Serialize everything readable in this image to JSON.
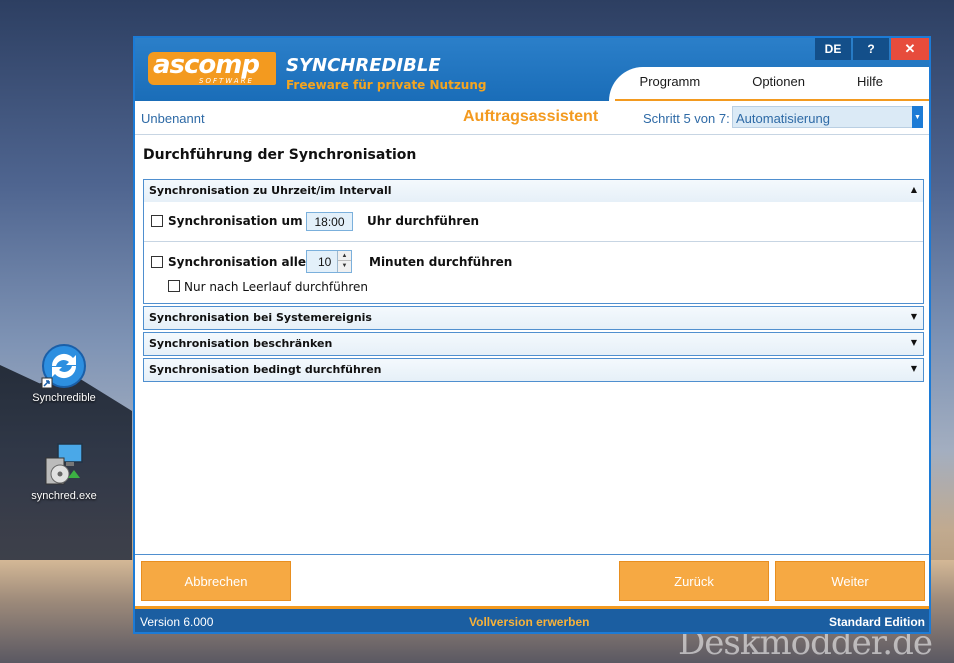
{
  "desktop": {
    "icons": [
      {
        "label": "Synchredible"
      },
      {
        "label": "synchred.exe"
      }
    ],
    "watermark": "Deskmodder.de"
  },
  "window": {
    "logo_main": "ascomp",
    "logo_sub": "SOFTWARE",
    "title": "SYNCHREDIBLE",
    "subtitle": "Freeware für private Nutzung",
    "controls": {
      "lang": "DE",
      "help": "?",
      "close": "✕"
    },
    "menu": [
      "Programm",
      "Optionen",
      "Hilfe"
    ]
  },
  "header": {
    "job_name": "Unbenannt",
    "wizard_title": "Auftragsassistent",
    "step_label": "Schritt 5 von 7:",
    "step_value": "Automatisierung"
  },
  "page": {
    "title": "Durchführung der Synchronisation"
  },
  "sections": {
    "time_interval": {
      "title": "Synchronisation zu Uhrzeit/im Intervall",
      "at_label": "Synchronisation um",
      "at_time": "18:00",
      "at_suffix": "Uhr durchführen",
      "every_label": "Synchronisation alle",
      "every_value": "10",
      "every_suffix": "Minuten durchführen",
      "idle_label": "Nur nach Leerlauf durchführen"
    },
    "system_event": {
      "title": "Synchronisation bei Systemereignis"
    },
    "restrict": {
      "title": "Synchronisation beschränken"
    },
    "conditional": {
      "title": "Synchronisation bedingt durchführen"
    }
  },
  "buttons": {
    "cancel": "Abbrechen",
    "back": "Zurück",
    "next": "Weiter"
  },
  "status": {
    "version": "Version 6.000",
    "buy": "Vollversion erwerben",
    "edition": "Standard Edition"
  },
  "colors": {
    "accent_orange": "#f39a1f",
    "accent_blue": "#1c7bd6",
    "status_blue": "#1b5ea1"
  }
}
